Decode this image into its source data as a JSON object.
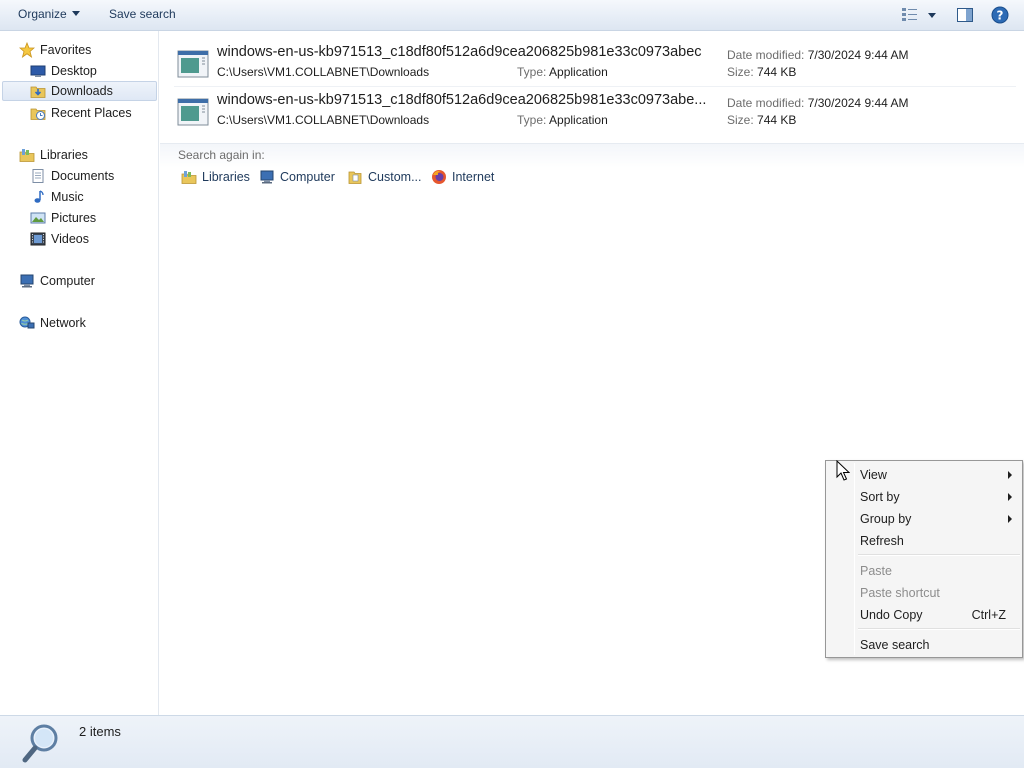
{
  "toolbar": {
    "organize_label": "Organize",
    "save_search_label": "Save search",
    "icons": [
      "views-icon",
      "preview-pane-icon",
      "help-icon"
    ]
  },
  "nav": {
    "favorites": {
      "label": "Favorites",
      "items": [
        {
          "label": "Desktop",
          "icon": "desktop-icon"
        },
        {
          "label": "Downloads",
          "icon": "downloads-folder-icon",
          "selected": true
        },
        {
          "label": "Recent Places",
          "icon": "recent-places-icon"
        }
      ]
    },
    "libraries": {
      "label": "Libraries",
      "items": [
        {
          "label": "Documents",
          "icon": "documents-icon"
        },
        {
          "label": "Music",
          "icon": "music-icon"
        },
        {
          "label": "Pictures",
          "icon": "pictures-icon"
        },
        {
          "label": "Videos",
          "icon": "videos-icon"
        }
      ]
    },
    "computer": {
      "label": "Computer"
    },
    "network": {
      "label": "Network"
    }
  },
  "results": [
    {
      "name": "windows-en-us-kb971513_c18df80f512a6d9cea206825b981e33c0973abec",
      "path": "C:\\Users\\VM1.COLLABNET\\Downloads",
      "type_label": "Type:",
      "type": "Application",
      "date_label": "Date modified:",
      "date": "7/30/2024 9:44 AM",
      "size_label": "Size:",
      "size": "744 KB"
    },
    {
      "name": "windows-en-us-kb971513_c18df80f512a6d9cea206825b981e33c0973abe...",
      "path": "C:\\Users\\VM1.COLLABNET\\Downloads",
      "type_label": "Type:",
      "type": "Application",
      "date_label": "Date modified:",
      "date": "7/30/2024 9:44 AM",
      "size_label": "Size:",
      "size": "744 KB"
    }
  ],
  "search_again": {
    "label": "Search again in:",
    "items": [
      "Libraries",
      "Computer",
      "Custom...",
      "Internet"
    ]
  },
  "status": {
    "items_count": "2 items"
  },
  "context_menu": {
    "items": [
      {
        "label": "View",
        "submenu": true
      },
      {
        "label": "Sort by",
        "submenu": true
      },
      {
        "label": "Group by",
        "submenu": true
      },
      {
        "label": "Refresh"
      },
      {
        "label": "Paste",
        "disabled": true
      },
      {
        "label": "Paste shortcut",
        "disabled": true
      },
      {
        "label": "Undo Copy",
        "shortcut": "Ctrl+Z"
      },
      {
        "label": "Save search"
      }
    ]
  },
  "colors": {
    "accent": "#1e395b",
    "selection": "#dfe8f5"
  }
}
